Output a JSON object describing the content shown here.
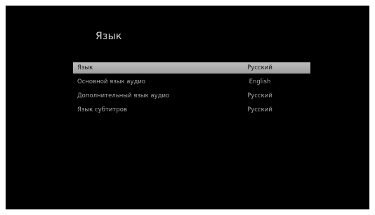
{
  "screen": {
    "title": "Язык"
  },
  "menu": {
    "items": [
      {
        "label": "Язык",
        "value": "Русский",
        "selected": true
      },
      {
        "label": "Основной язык аудио",
        "value": "English",
        "selected": false
      },
      {
        "label": "Дополнительный язык аудио",
        "value": "Русский",
        "selected": false
      },
      {
        "label": "Язык субтитров",
        "value": "Русский",
        "selected": false
      }
    ]
  },
  "colors": {
    "background": "#000000",
    "highlight": "#b0b0b0",
    "text": "#a9a9a9"
  }
}
